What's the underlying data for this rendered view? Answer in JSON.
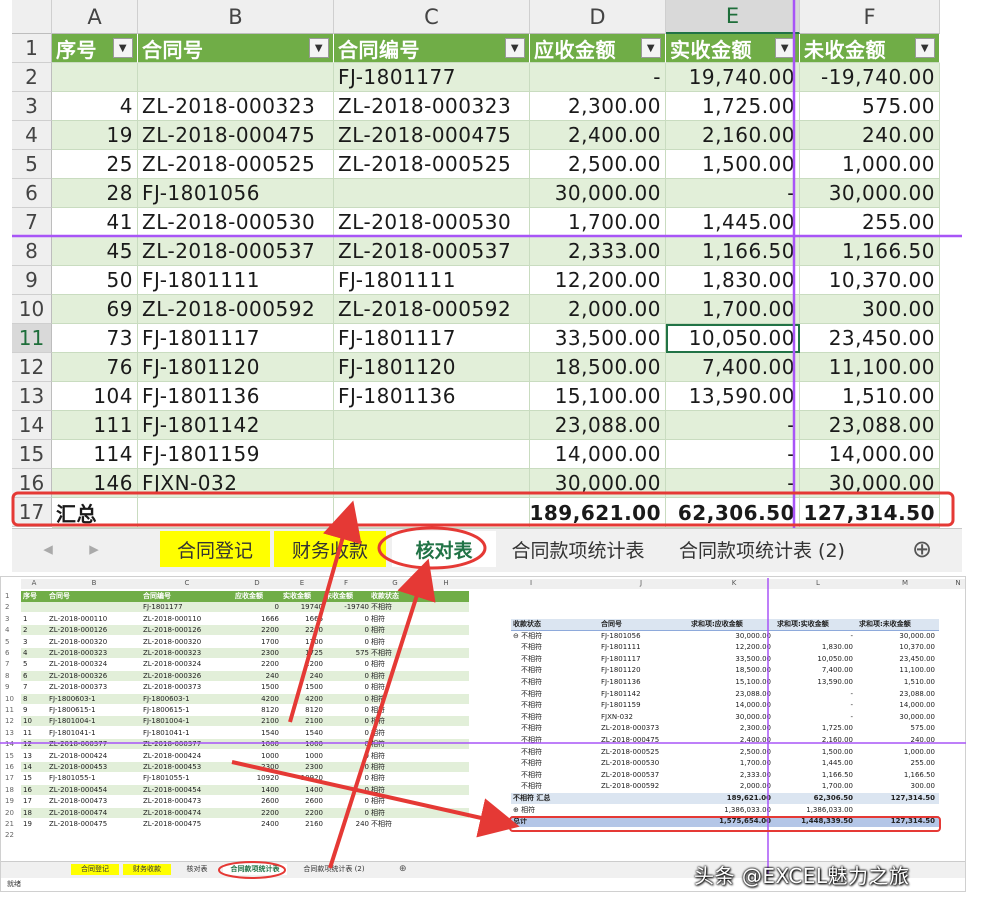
{
  "top": {
    "columns": [
      "A",
      "B",
      "C",
      "D",
      "E",
      "F"
    ],
    "headers": [
      "序号",
      "合同号",
      "合同编号",
      "应收金额",
      "实收金额",
      "未收金额"
    ],
    "rows": [
      {
        "num": "2",
        "a": "",
        "b": "",
        "c": "FJ-1801177",
        "d": "-",
        "e": "19,740.00",
        "f": "-19,740.00"
      },
      {
        "num": "3",
        "a": "4",
        "b": "ZL-2018-000323",
        "c": "ZL-2018-000323",
        "d": "2,300.00",
        "e": "1,725.00",
        "f": "575.00"
      },
      {
        "num": "4",
        "a": "19",
        "b": "ZL-2018-000475",
        "c": "ZL-2018-000475",
        "d": "2,400.00",
        "e": "2,160.00",
        "f": "240.00"
      },
      {
        "num": "5",
        "a": "25",
        "b": "ZL-2018-000525",
        "c": "ZL-2018-000525",
        "d": "2,500.00",
        "e": "1,500.00",
        "f": "1,000.00"
      },
      {
        "num": "6",
        "a": "28",
        "b": "FJ-1801056",
        "c": "",
        "d": "30,000.00",
        "e": "-",
        "f": "30,000.00"
      },
      {
        "num": "7",
        "a": "41",
        "b": "ZL-2018-000530",
        "c": "ZL-2018-000530",
        "d": "1,700.00",
        "e": "1,445.00",
        "f": "255.00"
      },
      {
        "num": "8",
        "a": "45",
        "b": "ZL-2018-000537",
        "c": "ZL-2018-000537",
        "d": "2,333.00",
        "e": "1,166.50",
        "f": "1,166.50"
      },
      {
        "num": "9",
        "a": "50",
        "b": "FJ-1801111",
        "c": "FJ-1801111",
        "d": "12,200.00",
        "e": "1,830.00",
        "f": "10,370.00"
      },
      {
        "num": "10",
        "a": "69",
        "b": "ZL-2018-000592",
        "c": "ZL-2018-000592",
        "d": "2,000.00",
        "e": "1,700.00",
        "f": "300.00"
      },
      {
        "num": "11",
        "a": "73",
        "b": "FJ-1801117",
        "c": "FJ-1801117",
        "d": "33,500.00",
        "e": "10,050.00",
        "f": "23,450.00"
      },
      {
        "num": "12",
        "a": "76",
        "b": "FJ-1801120",
        "c": "FJ-1801120",
        "d": "18,500.00",
        "e": "7,400.00",
        "f": "11,100.00"
      },
      {
        "num": "13",
        "a": "104",
        "b": "FJ-1801136",
        "c": "FJ-1801136",
        "d": "15,100.00",
        "e": "13,590.00",
        "f": "1,510.00"
      },
      {
        "num": "14",
        "a": "111",
        "b": "FJ-1801142",
        "c": "",
        "d": "23,088.00",
        "e": "-",
        "f": "23,088.00"
      },
      {
        "num": "15",
        "a": "114",
        "b": "FJ-1801159",
        "c": "",
        "d": "14,000.00",
        "e": "-",
        "f": "14,000.00"
      },
      {
        "num": "16",
        "a": "146",
        "b": "FJXN-032",
        "c": "",
        "d": "30,000.00",
        "e": "-",
        "f": "30,000.00"
      }
    ],
    "total": {
      "num": "17",
      "label": "汇总",
      "d": "189,621.00",
      "e": "62,306.50",
      "f": "127,314.50"
    },
    "tabs": [
      "合同登记",
      "财务收款",
      "核对表",
      "合同款项统计表",
      "合同款项统计表 (2)"
    ],
    "add_sheet": "⊕"
  },
  "bottom": {
    "columns": [
      "A",
      "B",
      "C",
      "D",
      "E",
      "F",
      "G",
      "H",
      "I",
      "J",
      "K",
      "L",
      "M",
      "N"
    ],
    "headers": [
      "序号",
      "合同号",
      "合同编号",
      "应收金额",
      "实收金额",
      "未收金额",
      "收款状态"
    ],
    "rows": [
      [
        "",
        "",
        "FJ-1801177",
        "0",
        "19740",
        "-19740",
        "不相符"
      ],
      [
        "1",
        "ZL-2018-000110",
        "ZL-2018-000110",
        "1666",
        "1666",
        "0",
        "相符"
      ],
      [
        "2",
        "ZL-2018-000126",
        "ZL-2018-000126",
        "2200",
        "2200",
        "0",
        "相符"
      ],
      [
        "3",
        "ZL-2018-000320",
        "ZL-2018-000320",
        "1700",
        "1700",
        "0",
        "相符"
      ],
      [
        "4",
        "ZL-2018-000323",
        "ZL-2018-000323",
        "2300",
        "1725",
        "575",
        "不相符"
      ],
      [
        "5",
        "ZL-2018-000324",
        "ZL-2018-000324",
        "2200",
        "2200",
        "0",
        "相符"
      ],
      [
        "6",
        "ZL-2018-000326",
        "ZL-2018-000326",
        "240",
        "240",
        "0",
        "相符"
      ],
      [
        "7",
        "ZL-2018-000373",
        "ZL-2018-000373",
        "1500",
        "1500",
        "0",
        "相符"
      ],
      [
        "8",
        "FJ-1800603-1",
        "FJ-1800603-1",
        "4200",
        "4200",
        "0",
        "相符"
      ],
      [
        "9",
        "FJ-1800615-1",
        "FJ-1800615-1",
        "8120",
        "8120",
        "0",
        "相符"
      ],
      [
        "10",
        "FJ-1801004-1",
        "FJ-1801004-1",
        "2100",
        "2100",
        "0",
        "相符"
      ],
      [
        "11",
        "FJ-1801041-1",
        "FJ-1801041-1",
        "1540",
        "1540",
        "0",
        "相符"
      ],
      [
        "12",
        "ZL-2018-000377",
        "ZL-2018-000377",
        "1000",
        "1000",
        "0",
        "相符"
      ],
      [
        "13",
        "ZL-2018-000424",
        "ZL-2018-000424",
        "1000",
        "1000",
        "0",
        "相符"
      ],
      [
        "14",
        "ZL-2018-000453",
        "ZL-2018-000453",
        "2300",
        "2300",
        "0",
        "相符"
      ],
      [
        "15",
        "FJ-1801055-1",
        "FJ-1801055-1",
        "10920",
        "10920",
        "0",
        "相符"
      ],
      [
        "16",
        "ZL-2018-000454",
        "ZL-2018-000454",
        "1400",
        "1400",
        "0",
        "相符"
      ],
      [
        "17",
        "ZL-2018-000473",
        "ZL-2018-000473",
        "2600",
        "2600",
        "0",
        "相符"
      ],
      [
        "18",
        "ZL-2018-000474",
        "ZL-2018-000474",
        "2200",
        "2200",
        "0",
        "相符"
      ],
      [
        "19",
        "ZL-2018-000475",
        "ZL-2018-000475",
        "2400",
        "2160",
        "240",
        "不相符"
      ]
    ],
    "pivot_headers": [
      "收款状态",
      "合同号",
      "求和项:应收金额",
      "求和项:实收金额",
      "求和项:未收金额"
    ],
    "pivot_rows": [
      [
        "⊖ 不相符",
        "FJ-1801056",
        "30,000.00",
        "-",
        "30,000.00"
      ],
      [
        "不相符",
        "FJ-1801111",
        "12,200.00",
        "1,830.00",
        "10,370.00"
      ],
      [
        "不相符",
        "FJ-1801117",
        "33,500.00",
        "10,050.00",
        "23,450.00"
      ],
      [
        "不相符",
        "FJ-1801120",
        "18,500.00",
        "7,400.00",
        "11,100.00"
      ],
      [
        "不相符",
        "FJ-1801136",
        "15,100.00",
        "13,590.00",
        "1,510.00"
      ],
      [
        "不相符",
        "FJ-1801142",
        "23,088.00",
        "-",
        "23,088.00"
      ],
      [
        "不相符",
        "FJ-1801159",
        "14,000.00",
        "-",
        "14,000.00"
      ],
      [
        "不相符",
        "FJXN-032",
        "30,000.00",
        "-",
        "30,000.00"
      ],
      [
        "不相符",
        "ZL-2018-000373",
        "2,300.00",
        "1,725.00",
        "575.00"
      ],
      [
        "不相符",
        "ZL-2018-000475",
        "2,400.00",
        "2,160.00",
        "240.00"
      ],
      [
        "不相符",
        "ZL-2018-000525",
        "2,500.00",
        "1,500.00",
        "1,000.00"
      ],
      [
        "不相符",
        "ZL-2018-000530",
        "1,700.00",
        "1,445.00",
        "255.00"
      ],
      [
        "不相符",
        "ZL-2018-000537",
        "2,333.00",
        "1,166.50",
        "1,166.50"
      ],
      [
        "不相符",
        "ZL-2018-000592",
        "2,000.00",
        "1,700.00",
        "300.00"
      ]
    ],
    "pivot_subtotal": [
      "不相符 汇总",
      "",
      "189,621.00",
      "62,306.50",
      "127,314.50"
    ],
    "pivot_other": [
      "⊕ 相符",
      "",
      "1,386,033.00",
      "1,386,033.00",
      ""
    ],
    "pivot_total": [
      "总计",
      "",
      "1,575,654.00",
      "1,448,339.50",
      "127,314.50"
    ],
    "tabs": [
      "合同登记",
      "财务收款",
      "核对表",
      "合同款项统计表",
      "合同款项统计表 (2)"
    ],
    "status": "就绪"
  },
  "watermark": "头条 @EXCEL魅力之旅",
  "colors": {
    "header_green": "#70ad47",
    "band_green": "#e2efd9",
    "highlight_red": "#e53935",
    "guide_purple": "#a855f7",
    "tab_yellow": "#ffff00"
  }
}
